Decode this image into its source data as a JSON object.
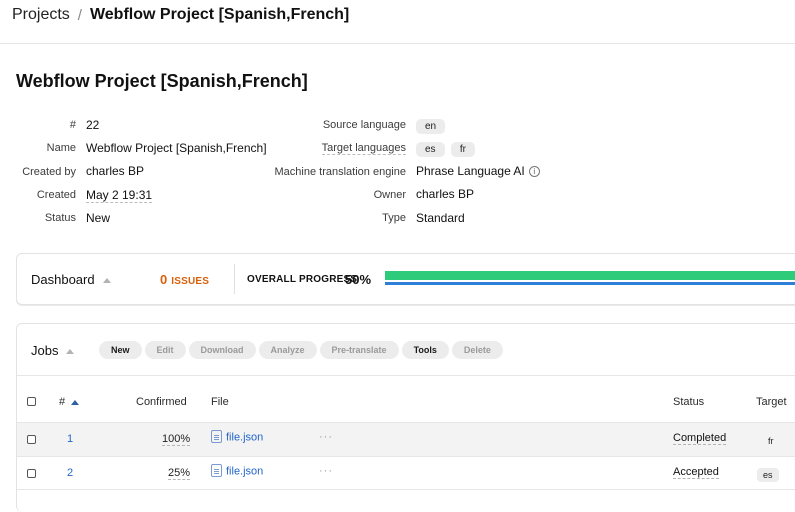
{
  "breadcrumb": {
    "root": "Projects",
    "separator": "/",
    "current": "Webflow Project [Spanish,French]"
  },
  "project": {
    "title": "Webflow Project [Spanish,French]",
    "left": [
      {
        "label": "#",
        "value": "22"
      },
      {
        "label": "Name",
        "value": "Webflow Project [Spanish,French]"
      },
      {
        "label": "Created by",
        "value": "charles BP"
      },
      {
        "label": "Created",
        "value": "May 2 19:31"
      },
      {
        "label": "Status",
        "value": "New"
      }
    ],
    "right": {
      "source_language_label": "Source language",
      "source_language": "en",
      "target_languages_label": "Target languages",
      "target_languages": [
        "es",
        "fr"
      ],
      "mt_engine_label": "Machine translation engine",
      "mt_engine": "Phrase Language AI",
      "owner_label": "Owner",
      "owner": "charles BP",
      "type_label": "Type",
      "type": "Standard"
    }
  },
  "dashboard": {
    "title": "Dashboard",
    "issues_count": "0",
    "issues_label": "ISSUES",
    "progress_label": "OVERALL PROGRESS",
    "progress_percent": "50%",
    "progress_value": 0.5,
    "colors": {
      "issues": "#d9600b",
      "progress_green": "#2ecc7a",
      "progress_blue": "#2d7fd8"
    }
  },
  "jobs": {
    "title": "Jobs",
    "toolbar": {
      "new": "New",
      "edit": "Edit",
      "download": "Download",
      "analyze": "Analyze",
      "pretranslate": "Pre-translate",
      "tools": "Tools",
      "delete": "Delete"
    },
    "columns": {
      "num": "#",
      "confirmed": "Confirmed",
      "file": "File",
      "status": "Status",
      "target": "Target"
    },
    "rows": [
      {
        "num": "1",
        "confirmed": "100%",
        "file": "file.json",
        "more": "···",
        "status": "Completed",
        "target": "fr"
      },
      {
        "num": "2",
        "confirmed": "25%",
        "file": "file.json",
        "more": "···",
        "status": "Accepted",
        "target": "es"
      }
    ]
  }
}
